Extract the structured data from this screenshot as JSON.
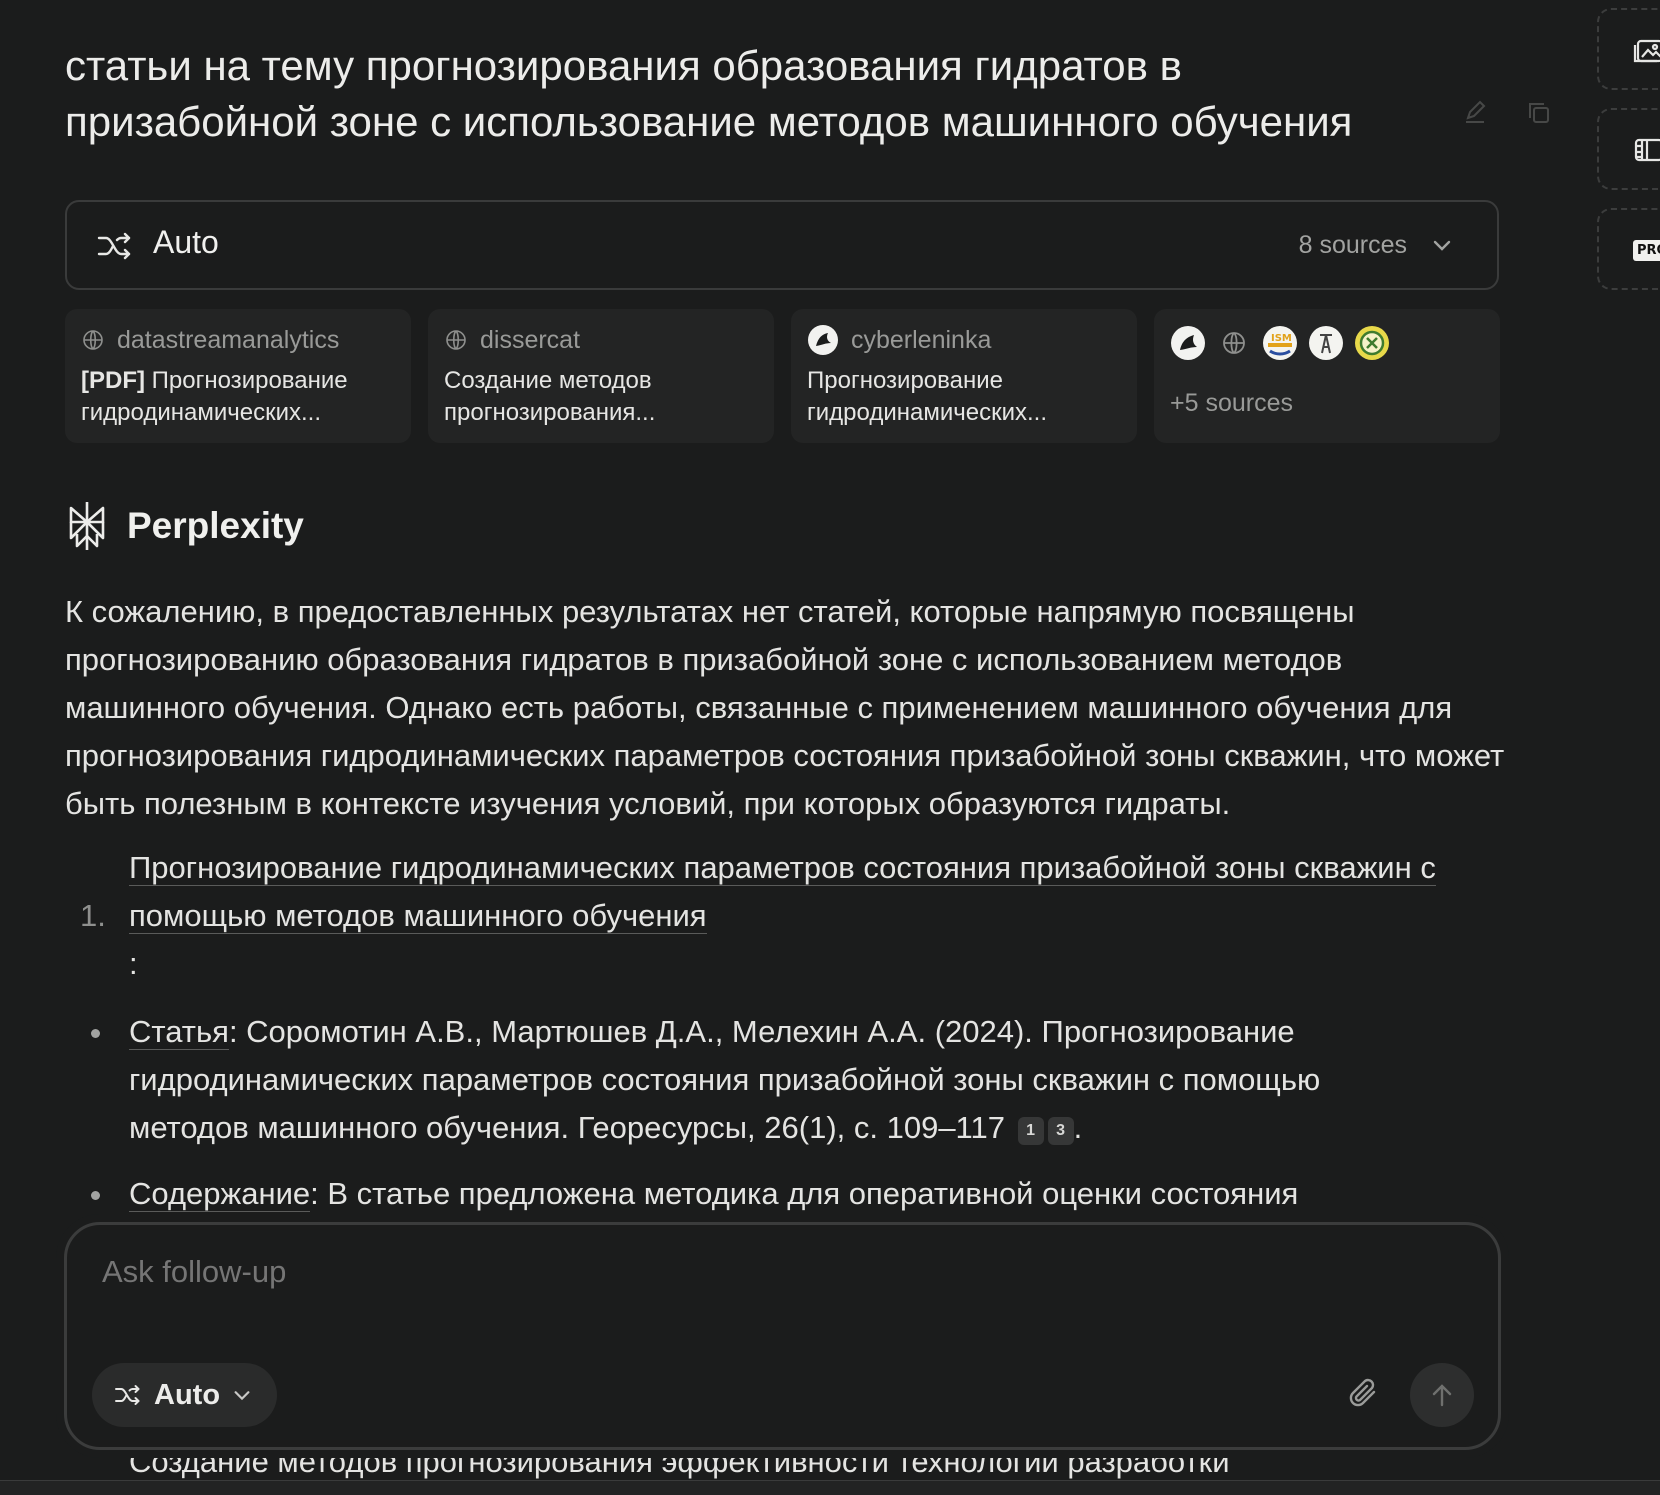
{
  "query": "статьи на тему прогнозирования образования гидратов в призабойной зоне с использование методов машинного обучения",
  "search_bar": {
    "mode": "Auto",
    "sources_count": "8 sources"
  },
  "source_cards": [
    {
      "source": "datastreamanalytics",
      "prefix": "[PDF]",
      "title": " Прогнозирование гидродинамических..."
    },
    {
      "source": "dissercat",
      "prefix": "",
      "title": "Создание методов прогнозирования..."
    },
    {
      "source": "cyberleninka",
      "prefix": "",
      "title": "Прогнозирование гидродинамических..."
    }
  ],
  "more_sources": "+5 sources",
  "answer_header": "Perplexity",
  "answer": {
    "intro": "К сожалению, в предоставленных результатах нет статей, которые напрямую посвящены прогнозированию образования гидратов в призабойной зоне с использованием методов машинного обучения. Однако есть работы, связанные с применением машинного обучения для прогнозирования гидродинамических параметров состояния призабойной зоны скважин, что может быть полезным в контексте изучения условий, при которых образуются гидраты.",
    "item_number": "1.",
    "item_title": "Прогнозирование гидродинамических параметров состояния призабойной зоны скважин с помощью методов машинного обучения",
    "item_colon": ":",
    "bullet1_key": "Статья",
    "bullet1_text": ": Соромотин А.В., Мартюшев Д.А., Мелехин А.А. (2024). Прогнозирование гидродинамических параметров состояния призабойной зоны скважин с помощью методов машинного обучения. Георесурсы, 26(1), с. 109–117",
    "bullet1_cite1": "1",
    "bullet1_cite2": "3",
    "bullet1_end": ".",
    "bullet2_key": "Содержание",
    "bullet2_text": ": В статье предложена методика для оперативной оценки состояния",
    "tail": "Создание методов прогнозирования эффективности технологий разработки"
  },
  "composer": {
    "placeholder": "Ask follow-up",
    "mode": "Auto"
  },
  "rail": {
    "pro_label": "PRO"
  }
}
